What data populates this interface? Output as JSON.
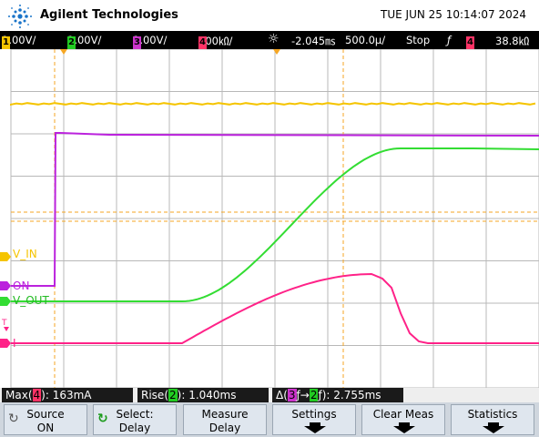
{
  "header": {
    "brand": "Agilent Technologies",
    "datetime": "TUE JUN 25 10:14:07 2024",
    "logo_icon": "agilent-spark-icon"
  },
  "status": {
    "channels": [
      {
        "num": "1",
        "scale": "1.00V/",
        "color": "#f5c400"
      },
      {
        "num": "2",
        "scale": "1.00V/",
        "color": "#22cc22"
      },
      {
        "num": "3",
        "scale": "1.00V/",
        "color": "#cc33cc"
      },
      {
        "num": "4",
        "scale": "100㏀/",
        "color": "#ff3366"
      }
    ],
    "trigger_icon": "sun-brightness-icon",
    "delay": "-2.045㎳",
    "timebase": "500.0µ/",
    "run_state": "Stop",
    "edge_icon": "falling-edge-icon",
    "trigger_channel": "4",
    "trigger_level": "38.8㏀"
  },
  "screen": {
    "labels": {
      "ch1": "V_IN",
      "ch3": "ON",
      "ch2": "V_OUT",
      "ch4": "I",
      "trigger_marker": "T"
    },
    "colors": {
      "ch1": "#f5c400",
      "ch2": "#33dd33",
      "ch3": "#bb22dd",
      "ch4": "#ff2288",
      "cursor": "#f5a623",
      "grid": "#b8b8b8"
    }
  },
  "measurements": [
    {
      "name": "Max",
      "channel": "4",
      "value": "163mA"
    },
    {
      "name": "Rise",
      "channel": "2",
      "value": "1.040ms"
    },
    {
      "name": "Δ",
      "channel_from": "3",
      "channel_to": "2",
      "value": "2.755ms"
    }
  ],
  "softkeys": [
    {
      "line1": "Source",
      "line2": "ON",
      "icon": "rotate-knob-icon"
    },
    {
      "line1": "Select:",
      "line2": "Delay",
      "icon": "select-knob-icon"
    },
    {
      "line1": "Measure",
      "line2": "Delay"
    },
    {
      "line1": "Settings",
      "arrow": true
    },
    {
      "line1": "Clear Meas",
      "arrow": true
    },
    {
      "line1": "Statistics",
      "arrow": true
    }
  ]
}
